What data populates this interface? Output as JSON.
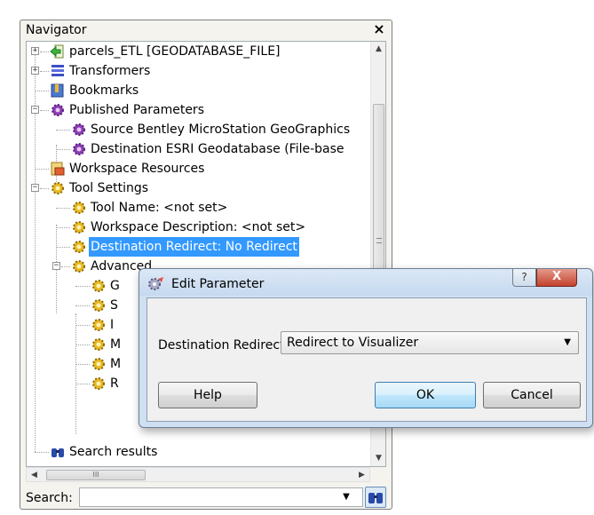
{
  "navigator": {
    "title": "Navigator",
    "close_icon": "×",
    "tree": [
      {
        "label": "parcels_ETL [GEODATABASE_FILE]",
        "icon": "green-arrow-icon",
        "expander": "+"
      },
      {
        "label": "Transformers",
        "icon": "transformers-icon",
        "expander": "+"
      },
      {
        "label": "Bookmarks",
        "icon": "bookmark-icon"
      },
      {
        "label": "Published Parameters",
        "icon": "gear-icon",
        "expander": "−"
      },
      {
        "label": "Source Bentley MicroStation GeoGraphics",
        "icon": "gear-icon"
      },
      {
        "label": "Destination ESRI Geodatabase (File-base",
        "icon": "gear-icon"
      },
      {
        "label": "Workspace Resources",
        "icon": "resources-icon"
      },
      {
        "label": "Tool Settings",
        "icon": "gear-yellow-icon",
        "expander": "−"
      },
      {
        "label": "Tool Name: <not set>",
        "icon": "gear-yellow-icon"
      },
      {
        "label": "Workspace Description: <not set>",
        "icon": "gear-yellow-icon"
      },
      {
        "label": "Destination Redirect: No Redirect",
        "icon": "gear-yellow-icon",
        "selected": true
      },
      {
        "label": "Advanced",
        "icon": "gear-yellow-icon",
        "expander": "−"
      },
      {
        "label": "G",
        "icon": "gear-yellow-icon"
      },
      {
        "label": "S",
        "icon": "gear-yellow-icon"
      },
      {
        "label": "I",
        "icon": "gear-yellow-icon"
      },
      {
        "label": "M",
        "icon": "gear-yellow-icon"
      },
      {
        "label": "M",
        "icon": "gear-yellow-icon"
      },
      {
        "label": "R",
        "icon": "gear-yellow-icon"
      },
      {
        "label": "Search results",
        "icon": "binoculars-icon"
      }
    ],
    "hscroll_thumb_glyph": "III",
    "search_label": "Search:",
    "search_value": ""
  },
  "dialog": {
    "title": "Edit Parameter",
    "help_q": "?",
    "close_x": "X",
    "field_label": "Destination Redirect:",
    "selected_option": "Redirect to Visualizer",
    "help_button": "Help",
    "ok_button": "OK",
    "cancel_button": "Cancel"
  }
}
